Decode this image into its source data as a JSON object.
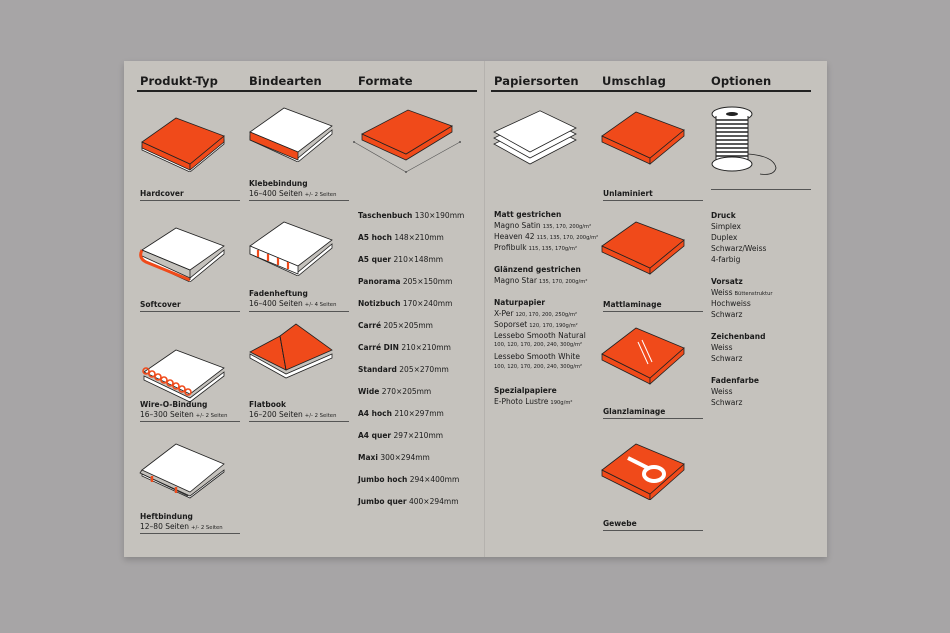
{
  "headers": {
    "produkt_typ": "Produkt-Typ",
    "bindearten": "Bindearten",
    "formate": "Formate",
    "papiersorten": "Papiersorten",
    "umschlag": "Umschlag",
    "optionen": "Optionen"
  },
  "produkt_typ": [
    {
      "label": "Hardcover",
      "range": "",
      "note": ""
    },
    {
      "label": "Softcover",
      "range": "",
      "note": ""
    },
    {
      "label": "Wire-O-Bindung",
      "range": "16–300 Seiten",
      "note": "+/- 2 Seiten"
    },
    {
      "label": "Heftbindung",
      "range": "12–80 Seiten",
      "note": "+/- 2 Seiten"
    }
  ],
  "bindearten": [
    {
      "label": "Klebebindung",
      "range": "16–400 Seiten",
      "note": "+/- 2 Seiten"
    },
    {
      "label": "Fadenheftung",
      "range": "16–400 Seiten",
      "note": "+/- 4 Seiten"
    },
    {
      "label": "Flatbook",
      "range": "16–200 Seiten",
      "note": "+/- 2 Seiten"
    }
  ],
  "formate": [
    {
      "name": "Taschenbuch",
      "size": "130×190mm"
    },
    {
      "name": "A5 hoch",
      "size": "148×210mm"
    },
    {
      "name": "A5 quer",
      "size": "210×148mm"
    },
    {
      "name": "Panorama",
      "size": "205×150mm"
    },
    {
      "name": "Notizbuch",
      "size": "170×240mm"
    },
    {
      "name": "Carré",
      "size": "205×205mm"
    },
    {
      "name": "Carré DIN",
      "size": "210×210mm"
    },
    {
      "name": "Standard",
      "size": "205×270mm"
    },
    {
      "name": "Wide",
      "size": "270×205mm"
    },
    {
      "name": "A4 hoch",
      "size": "210×297mm"
    },
    {
      "name": "A4 quer",
      "size": "297×210mm"
    },
    {
      "name": "Maxi",
      "size": "300×294mm"
    },
    {
      "name": "Jumbo hoch",
      "size": "294×400mm"
    },
    {
      "name": "Jumbo quer",
      "size": "400×294mm"
    }
  ],
  "papiersorten": [
    {
      "heading": "Matt gestrichen",
      "items": [
        {
          "name": "Magno Satin",
          "weights": "135, 170, 200g/m²"
        },
        {
          "name": "Heaven 42",
          "weights": "115, 135, 170, 200g/m²"
        },
        {
          "name": "Profibulk",
          "weights": "115, 135, 170g/m²"
        }
      ]
    },
    {
      "heading": "Glänzend gestrichen",
      "items": [
        {
          "name": "Magno Star",
          "weights": "135, 170, 200g/m²"
        }
      ]
    },
    {
      "heading": "Naturpapier",
      "items": [
        {
          "name": "X-Per",
          "weights": "120, 170, 200, 250g/m²"
        },
        {
          "name": "Soporset",
          "weights": "120, 170, 190g/m²"
        },
        {
          "name": "Lessebo Smooth Natural",
          "weights": "100, 120, 170, 200, 240, 300g/m²"
        },
        {
          "name": "Lessebo Smooth White",
          "weights": "100, 120, 170, 200, 240, 300g/m²"
        }
      ]
    },
    {
      "heading": "Spezialpapiere",
      "items": [
        {
          "name": "E-Photo Lustre",
          "weights": "190g/m²"
        }
      ]
    }
  ],
  "umschlag": [
    {
      "label": "Unlaminiert"
    },
    {
      "label": "Mattlaminage"
    },
    {
      "label": "Glanzlaminage"
    },
    {
      "label": "Gewebe"
    }
  ],
  "optionen": [
    {
      "heading": "Druck",
      "items": [
        {
          "name": "Simplex",
          "note": ""
        },
        {
          "name": "Duplex",
          "note": ""
        },
        {
          "name": "Schwarz/Weiss",
          "note": ""
        },
        {
          "name": "4-farbig",
          "note": ""
        }
      ]
    },
    {
      "heading": "Vorsatz",
      "items": [
        {
          "name": "Weiss",
          "note": "Büttenstruktur"
        },
        {
          "name": "Hochweiss",
          "note": ""
        },
        {
          "name": "Schwarz",
          "note": ""
        }
      ]
    },
    {
      "heading": "Zeichenband",
      "items": [
        {
          "name": "Weiss",
          "note": ""
        },
        {
          "name": "Schwarz",
          "note": ""
        }
      ]
    },
    {
      "heading": "Fadenfarbe",
      "items": [
        {
          "name": "Weiss",
          "note": ""
        },
        {
          "name": "Schwarz",
          "note": ""
        }
      ]
    }
  ],
  "colors": {
    "accent": "#f04a1a",
    "paper": "#c5c2bd",
    "background": "#a7a5a6",
    "ink": "#1b1b1b"
  }
}
